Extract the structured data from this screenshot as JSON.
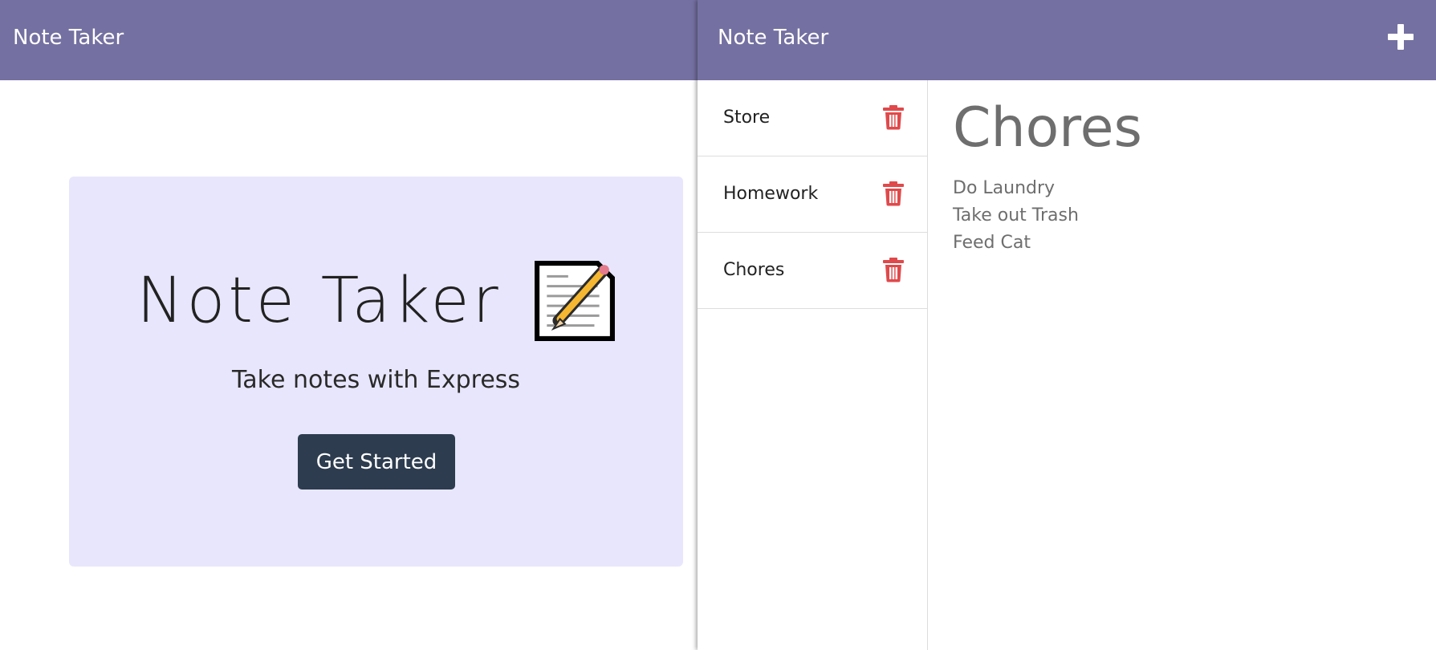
{
  "left_pane": {
    "navbar": {
      "brand": "Note Taker"
    },
    "hero": {
      "title": "Note Taker",
      "icon": "memo-icon",
      "subtitle": "Take notes with Express",
      "button_label": "Get Started"
    }
  },
  "right_pane": {
    "navbar": {
      "brand": "Note Taker",
      "add_icon": "plus-icon"
    },
    "notes": [
      {
        "title": "Store"
      },
      {
        "title": "Homework"
      },
      {
        "title": "Chores"
      }
    ],
    "active_note": {
      "title": "Chores",
      "lines": [
        "Do Laundry",
        "Take out Trash",
        "Feed Cat"
      ]
    }
  },
  "colors": {
    "navbar": "#7470a1",
    "jumbotron": "#e8e6fc",
    "button": "#2d3c4f",
    "trash": "#e0494b",
    "note_text": "#6e6e6e"
  }
}
